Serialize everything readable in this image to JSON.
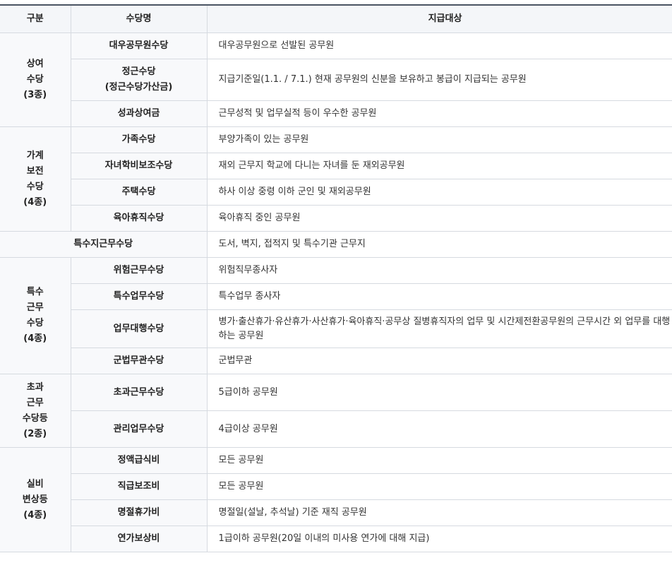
{
  "header": {
    "category": "구분",
    "name": "수당명",
    "target": "지급대상"
  },
  "groups": [
    {
      "category": "상여\n수당\n(3종)",
      "items": [
        {
          "name": "대우공무원수당",
          "target": "대우공무원으로 선발된 공무원"
        },
        {
          "name": "정근수당\n(정근수당가산금)",
          "target": "지급기준일(1.1. / 7.1.) 현재 공무원의 신분을 보유하고 봉급이 지급되는 공무원"
        },
        {
          "name": "성과상여금",
          "target": "근무성적 및 업무실적 등이 우수한 공무원"
        }
      ]
    },
    {
      "category": "가계\n보전\n수당\n(4종)",
      "items": [
        {
          "name": "가족수당",
          "target": "부양가족이 있는 공무원"
        },
        {
          "name": "자녀학비보조수당",
          "target": "재외 근무지 학교에 다니는 자녀를 둔 재외공무원"
        },
        {
          "name": "주택수당",
          "target": "하사 이상 중령 이하 군인 및 재외공무원"
        },
        {
          "name": "육아휴직수당",
          "target": "육아휴직 중인 공무원"
        }
      ]
    },
    {
      "name": "특수지근무수당",
      "target": "도서, 벽지, 접적지 및 특수기관 근무지"
    },
    {
      "category": "특수\n근무\n수당\n(4종)",
      "items": [
        {
          "name": "위험근무수당",
          "target": "위험직무종사자"
        },
        {
          "name": "특수업무수당",
          "target": "특수업무 종사자"
        },
        {
          "name": "업무대행수당",
          "target": "병가·출산휴가·유산휴가·사산휴가·육아휴직·공무상 질병휴직자의 업무 및 시간제전환공무원의 근무시간 외 업무를 대행 하는 공무원"
        },
        {
          "name": "군법무관수당",
          "target": "군법무관"
        }
      ]
    },
    {
      "category": "초과\n근무\n수당등\n(2종)",
      "items": [
        {
          "name": "초과근무수당",
          "target": "5급이하 공무원"
        },
        {
          "name": "관리업무수당",
          "target": "4급이상 공무원"
        }
      ]
    },
    {
      "category": "실비\n변상등\n(4종)",
      "items": [
        {
          "name": "정액급식비",
          "target": "모든 공무원"
        },
        {
          "name": "직급보조비",
          "target": "모든 공무원"
        },
        {
          "name": "명절휴가비",
          "target": "명절일(설날, 추석날) 기준 재직 공무원"
        },
        {
          "name": "연가보상비",
          "target": "1급이하 공무원(20일 이내의 미사용 연가에 대해 지급)"
        }
      ]
    }
  ]
}
